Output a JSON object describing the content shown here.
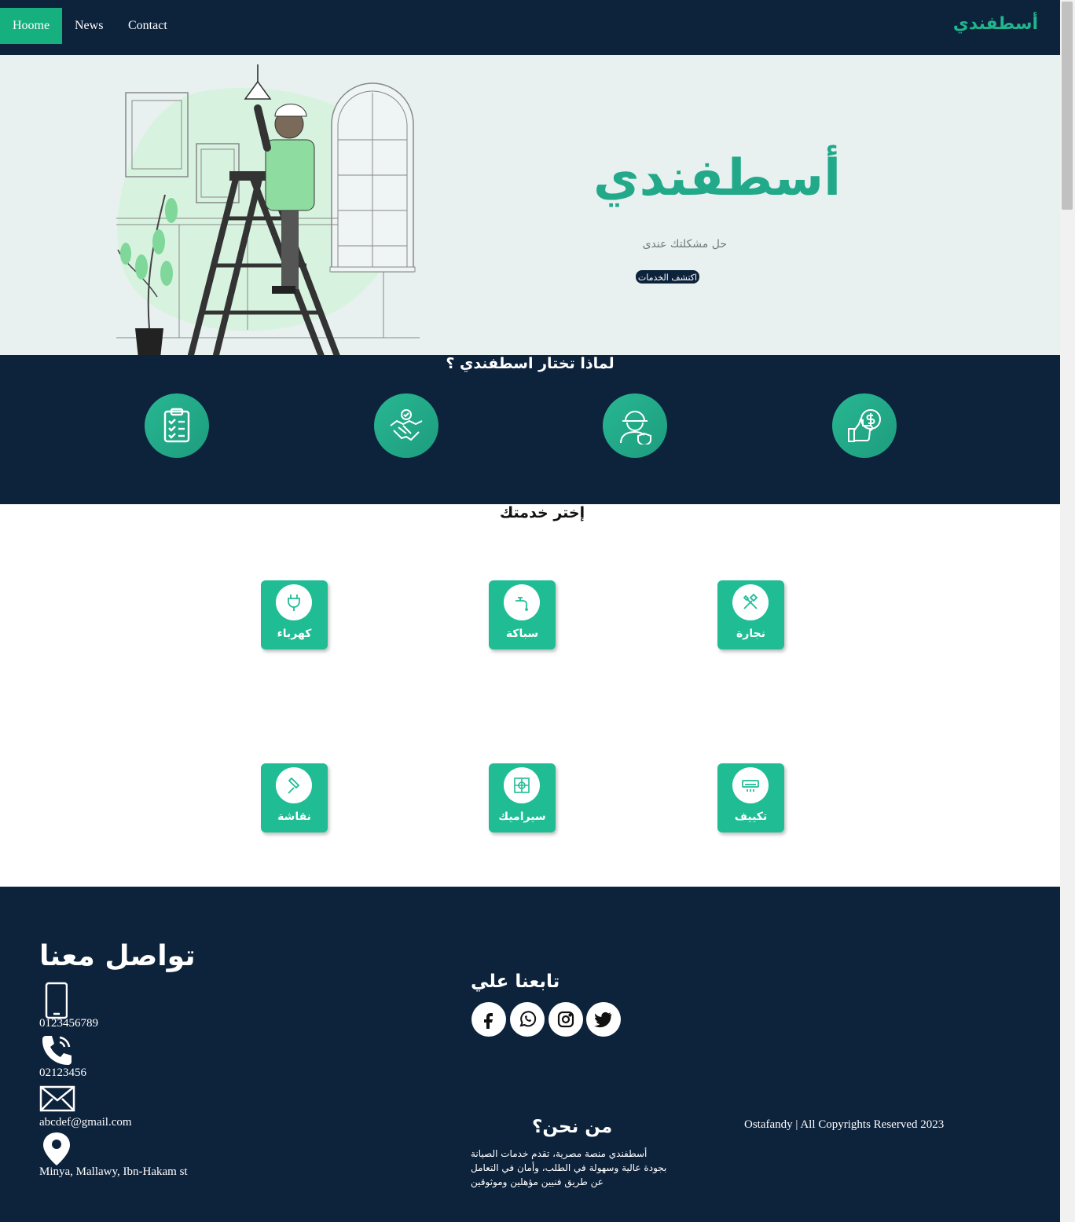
{
  "nav": {
    "items": [
      {
        "label": "Hoome",
        "active": true
      },
      {
        "label": "News",
        "active": false
      },
      {
        "label": "Contact",
        "active": false
      }
    ],
    "logo": "أسطفندي"
  },
  "hero": {
    "logo": "أسطفندي",
    "tagline": "حل مشكلتك عندى",
    "button": "اكتشف الخدمات"
  },
  "why": {
    "title": "لماذا تختار اسطفندي ؟",
    "features": [
      {
        "icon": "checklist-icon"
      },
      {
        "icon": "handshake-icon"
      },
      {
        "icon": "worker-shield-icon"
      },
      {
        "icon": "thumbs-up-dollar-icon"
      }
    ]
  },
  "services": {
    "title": "إختر خدمتك",
    "items": [
      {
        "label": "كهرباء",
        "icon": "plug-icon"
      },
      {
        "label": "سباكة",
        "icon": "faucet-icon"
      },
      {
        "label": "نجارة",
        "icon": "tools-icon"
      },
      {
        "label": "نقاشة",
        "icon": "paint-roller-icon"
      },
      {
        "label": "سيراميك",
        "icon": "tile-icon"
      },
      {
        "label": "تكييف",
        "icon": "air-conditioner-icon"
      }
    ]
  },
  "footer": {
    "contact_title": "تواصل معنا",
    "phone": "0123456789",
    "landline": "02123456",
    "email": "abcdef@gmail.com",
    "address": "Minya, Mallawy, Ibn-Hakam st",
    "follow_title": "تابعنا علي",
    "socials": [
      "facebook-icon",
      "whatsapp-icon",
      "instagram-icon",
      "twitter-icon"
    ],
    "about_title": "من نحن؟",
    "about_text": "أسطفندي منصة مصرية، تقدم خدمات الصيانة بجودة عالية وسهولة في الطلب، وأمان في التعامل عن طريق فنيين مؤهلين وموثوقين",
    "copyright": "Ostafandy | All Copyrights Reserved 2023"
  },
  "colors": {
    "navy": "#0d223b",
    "accent": "#16b07f",
    "card": "#20bd95",
    "hero_bg": "#e8f1f0"
  }
}
